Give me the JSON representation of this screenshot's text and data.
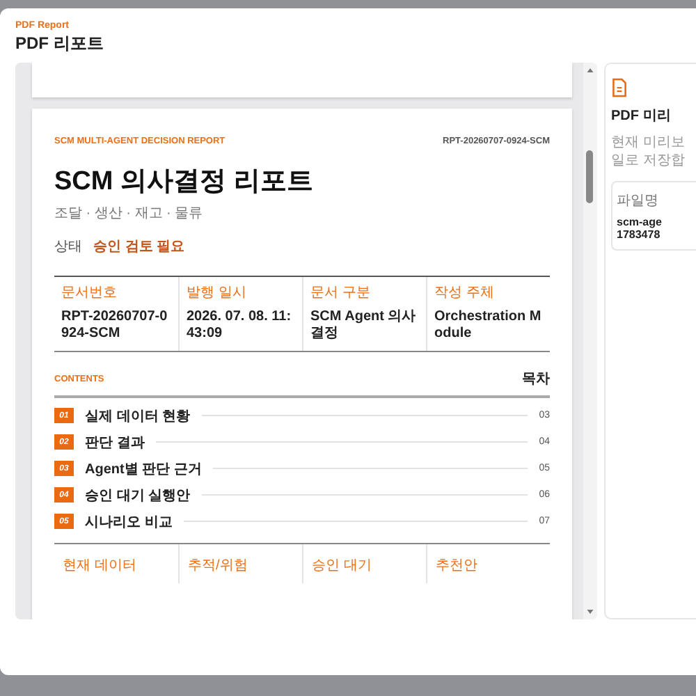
{
  "dialog": {
    "eyebrow": "PDF Report",
    "title": "PDF 리포트"
  },
  "report": {
    "eyebrow": "SCM MULTI-AGENT DECISION REPORT",
    "doc_id": "RPT-20260707-0924-SCM",
    "title": "SCM 의사결정 리포트",
    "subtitle": "조달 · 생산 · 재고 · 물류",
    "status_label": "상태",
    "status_value": "승인 검토 필요",
    "meta": [
      {
        "label": "문서번호",
        "value": "RPT-20260707-0924-SCM"
      },
      {
        "label": "발행 일시",
        "value": "2026. 07. 08. 11:43:09"
      },
      {
        "label": "문서 구분",
        "value": "SCM Agent 의사결정"
      },
      {
        "label": "작성 주체",
        "value": "Orchestration Module"
      }
    ],
    "contents_eyebrow": "CONTENTS",
    "contents_title": "목차",
    "toc": [
      {
        "number": "01",
        "title": "실제 데이터 현황",
        "page": "03"
      },
      {
        "number": "02",
        "title": "판단 결과",
        "page": "04"
      },
      {
        "number": "03",
        "title": "Agent별 판단 근거",
        "page": "05"
      },
      {
        "number": "04",
        "title": "승인 대기 실행안",
        "page": "06"
      },
      {
        "number": "05",
        "title": "시나리오 비교",
        "page": "07"
      }
    ],
    "summary_columns": [
      "현재 데이터",
      "추적/위험",
      "승인 대기",
      "추천안"
    ]
  },
  "side_panel": {
    "title": "PDF 미리",
    "description_lines": [
      "현재 미리보",
      "일로 저장합"
    ],
    "file_label": "파일명",
    "file_lines": [
      "scm-age",
      "1783478"
    ]
  }
}
